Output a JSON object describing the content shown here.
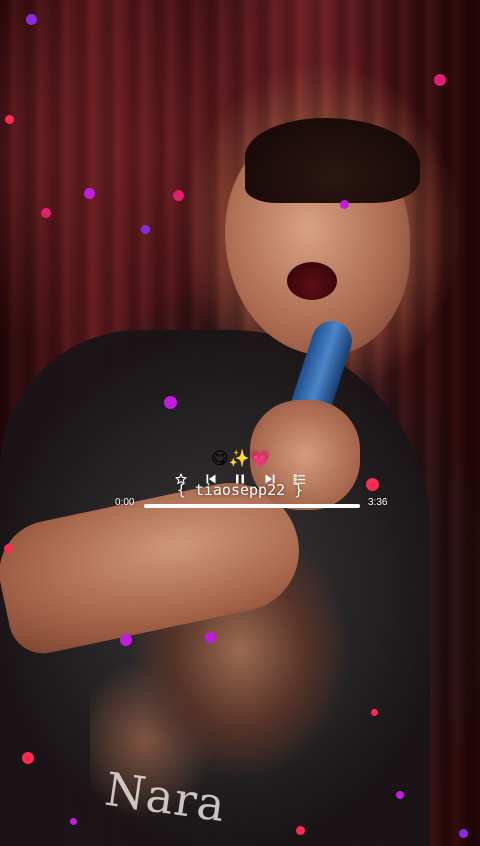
{
  "player": {
    "emoji_row": "😋✨💗",
    "handle": "{ tiaosepp22 }",
    "elapsed": "0:00",
    "total": "3:36",
    "progress": 1.0,
    "accent": "#ffffff",
    "icons": [
      "star-icon",
      "previous-icon",
      "pause-icon",
      "next-icon",
      "playlist-icon"
    ]
  },
  "background": {
    "shirt_text": "Nara"
  },
  "particles": {
    "colors": [
      "#c21ce0",
      "#e0206e",
      "#ff2a4f",
      "#8a2be2"
    ]
  }
}
